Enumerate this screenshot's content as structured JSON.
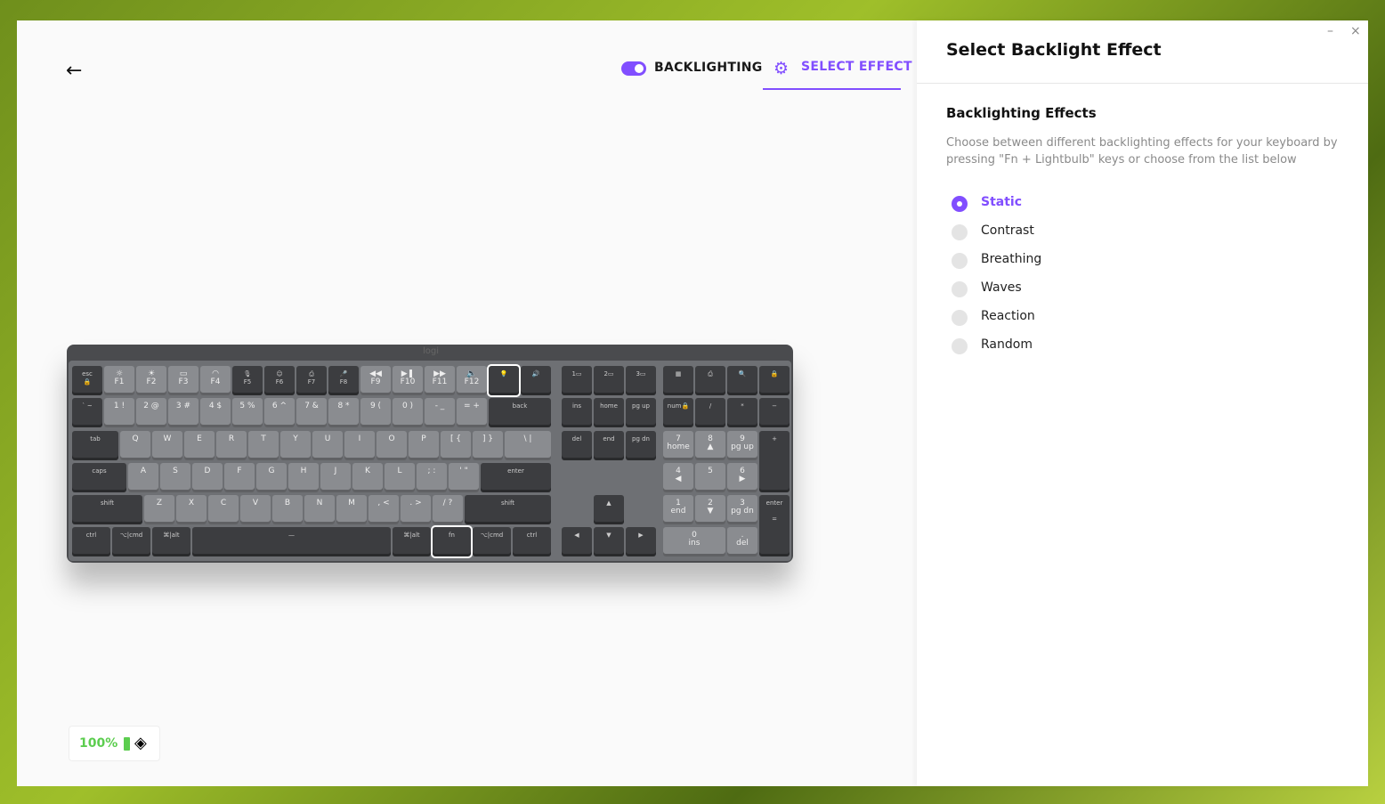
{
  "header": {
    "backlighting_label": "BACKLIGHTING",
    "backlighting_on": true,
    "select_effect_label": "SELECT EFFECT",
    "accent": "#814eff"
  },
  "battery": {
    "percent": "100%",
    "color": "#5ccd4f"
  },
  "window": {
    "minimize": "–",
    "close": "×"
  },
  "panel": {
    "title": "Select Backlight Effect",
    "section": "Backlighting Effects",
    "description": "Choose between different backlighting effects for your keyboard by pressing \"Fn + Lightbulb\" keys or choose from the list below",
    "options": [
      {
        "label": "Static",
        "selected": true
      },
      {
        "label": "Contrast",
        "selected": false
      },
      {
        "label": "Breathing",
        "selected": false
      },
      {
        "label": "Waves",
        "selected": false
      },
      {
        "label": "Reaction",
        "selected": false
      },
      {
        "label": "Random",
        "selected": false
      }
    ]
  },
  "keyboard": {
    "logo": "logi",
    "main": [
      [
        "esc\n🔒",
        "☼\nF1",
        "☀\nF2",
        "▭\nF3",
        "◠\nF4",
        "🎙\nF5",
        "☺\nF6",
        "⎙\nF7",
        "🎤\nF8",
        "◀◀\nF9",
        "▶❚\nF10",
        "▶▶\nF11",
        "🔈\nF12",
        "💡",
        "🔊"
      ],
      [
        "` ~",
        "1 !",
        "2 @",
        "3 #",
        "4 $",
        "5 %",
        "6 ^",
        "7 &",
        "8 *",
        "9 (",
        "0 )",
        "- _",
        "= +",
        "back"
      ],
      [
        "tab",
        "Q",
        "W",
        "E",
        "R",
        "T",
        "Y",
        "U",
        "I",
        "O",
        "P",
        "[ {",
        "] }",
        "\\ |"
      ],
      [
        "caps",
        "A",
        "S",
        "D",
        "F",
        "G",
        "H",
        "J",
        "K",
        "L",
        "; :",
        "' \"",
        "enter"
      ],
      [
        "shift",
        "Z",
        "X",
        "C",
        "V",
        "B",
        "N",
        "M",
        ", <",
        ". >",
        "/ ?",
        "shift"
      ],
      [
        "ctrl",
        "⌥|cmd",
        "⌘|alt",
        "—",
        "⌘|alt",
        "fn",
        "⌥|cmd",
        "ctrl"
      ]
    ],
    "nav": [
      [
        "1▭",
        "2▭",
        "3▭"
      ],
      [
        "ins",
        "home",
        "pg up"
      ],
      [
        "del",
        "end",
        "pg dn"
      ],
      [],
      [
        "",
        "▲",
        ""
      ],
      [
        "◀",
        "▼",
        "▶"
      ]
    ],
    "numpad": [
      [
        "▦",
        "⎙",
        "🔍",
        "🔒"
      ],
      [
        "num🔒",
        "/",
        "*",
        "−"
      ],
      [
        "7\nhome",
        "8\n▲",
        "9\npg up",
        "+"
      ],
      [
        "4\n◀",
        "5",
        "6\n▶"
      ],
      [
        "1\nend",
        "2\n▼",
        "3\npg dn",
        "enter\n\n="
      ],
      [
        "0\nins",
        ".\ndel"
      ]
    ]
  }
}
